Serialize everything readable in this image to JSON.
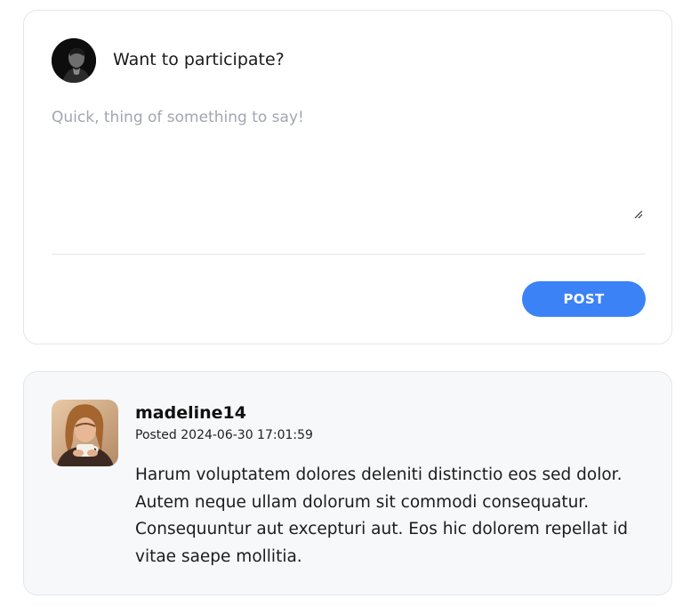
{
  "composer": {
    "title": "Want to participate?",
    "placeholder": "Quick, thing of something to say!",
    "post_label": "POST"
  },
  "comment": {
    "username": "madeline14",
    "posted_prefix": "Posted",
    "timestamp": "2024-06-30 17:01:59",
    "body": "Harum voluptatem dolores deleniti distinctio eos sed dolor. Autem neque ullam dolorum sit commodi consequatur. Consequuntur aut excepturi aut. Eos hic dolorem repellat id vitae saepe mollitia."
  },
  "colors": {
    "accent": "#3b82f6",
    "card_border": "#e3e6ea",
    "comment_background": "#f7f8fa",
    "placeholder": "#a2a6b0"
  },
  "icons": {
    "composer_avatar": "user-avatar",
    "comment_avatar": "user-avatar",
    "resize_handle": "resize-grip-icon"
  }
}
